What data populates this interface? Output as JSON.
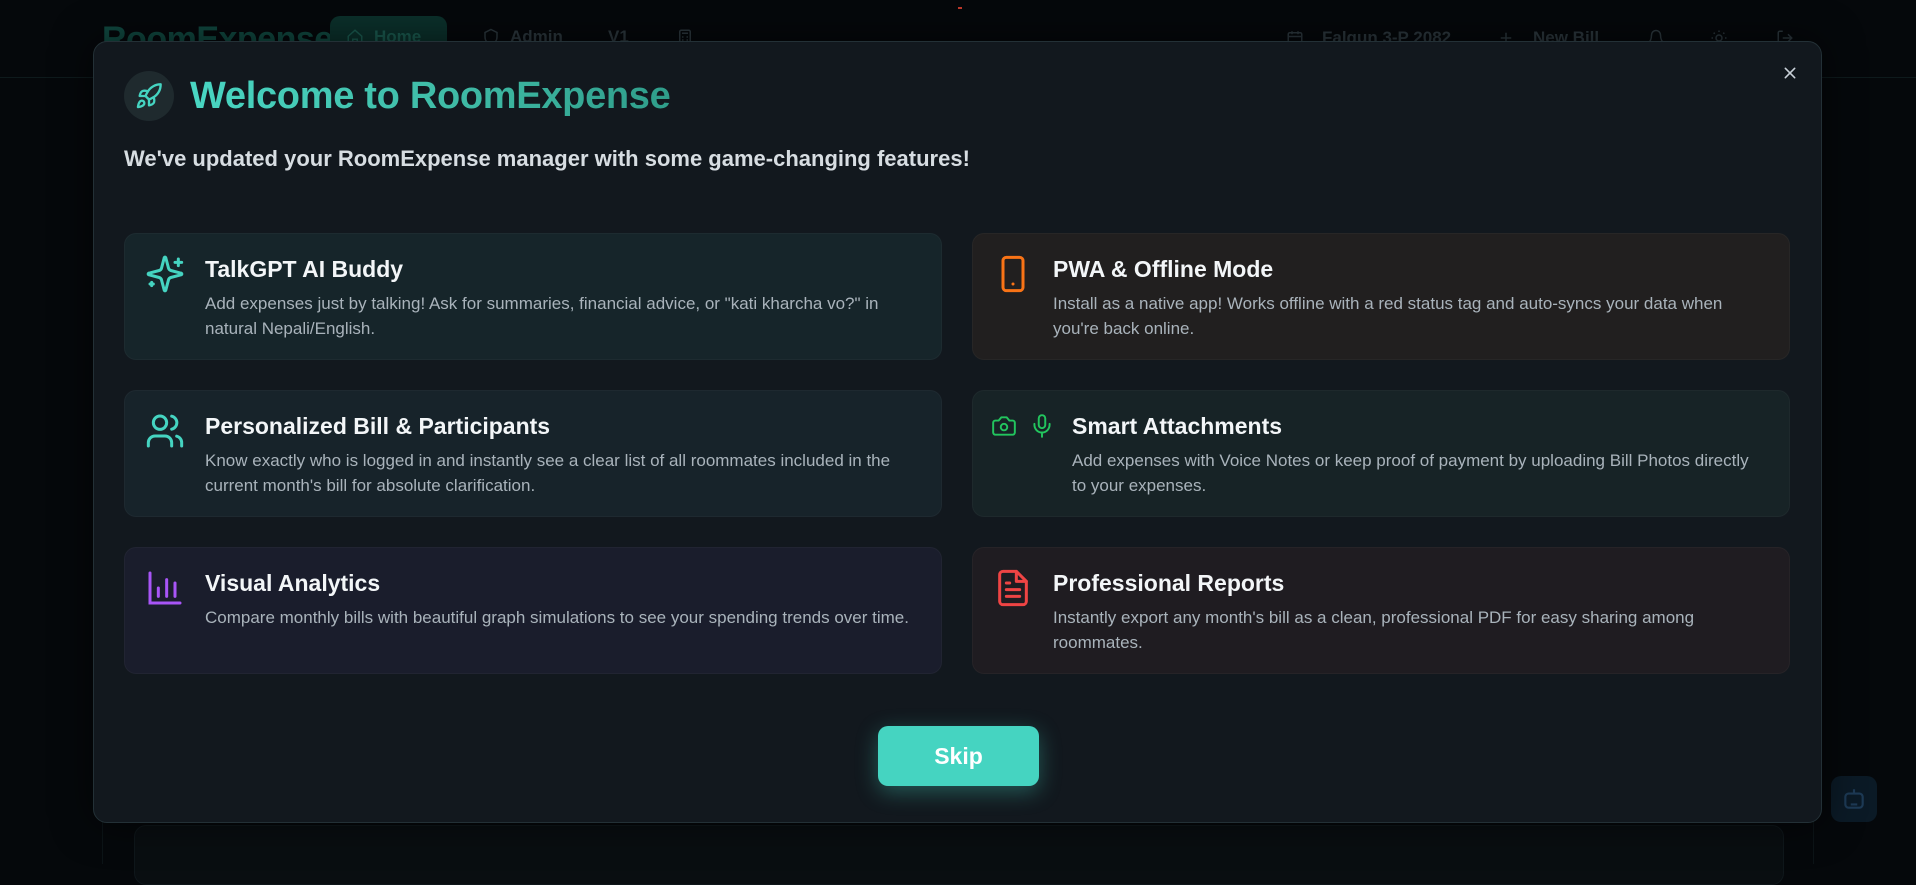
{
  "background": {
    "brand": "RoomExpense",
    "nav": {
      "home": "Home",
      "admin": "Admin",
      "version": "V1"
    },
    "header_right": {
      "date": "Falgun 3-P 2082",
      "new_bill": "New Bill"
    }
  },
  "modal": {
    "title": "Welcome to RoomExpense",
    "subtitle": "We've updated your RoomExpense manager with some game-changing features!",
    "features": [
      {
        "icon": "sparkles-icon",
        "title": "TalkGPT AI Buddy",
        "description": "Add expenses just by talking! Ask for summaries, financial advice, or \"kati kharcha vo?\" in natural Nepali/English."
      },
      {
        "icon": "smartphone-icon",
        "title": "PWA & Offline Mode",
        "description": "Install as a native app! Works offline with a red status tag and auto-syncs your data when you're back online."
      },
      {
        "icon": "users-icon",
        "title": "Personalized Bill & Participants",
        "description": "Know exactly who is logged in and instantly see a clear list of all roommates included in the current month's bill for absolute clarification."
      },
      {
        "icon": "camera-mic-icon",
        "title": "Smart Attachments",
        "description": "Add expenses with Voice Notes or keep proof of payment by uploading Bill Photos directly to your expenses."
      },
      {
        "icon": "bar-chart-icon",
        "title": "Visual Analytics",
        "description": "Compare monthly bills with beautiful graph simulations to see your spending trends over time."
      },
      {
        "icon": "file-text-icon",
        "title": "Professional Reports",
        "description": "Instantly export any month's bill as a clean, professional PDF for easy sharing among roommates."
      }
    ],
    "skip_label": "Skip"
  },
  "colors": {
    "accent": "#45d4c1",
    "orange": "#f97316",
    "green": "#22c55e",
    "purple": "#a855f7",
    "red": "#ef4444"
  }
}
